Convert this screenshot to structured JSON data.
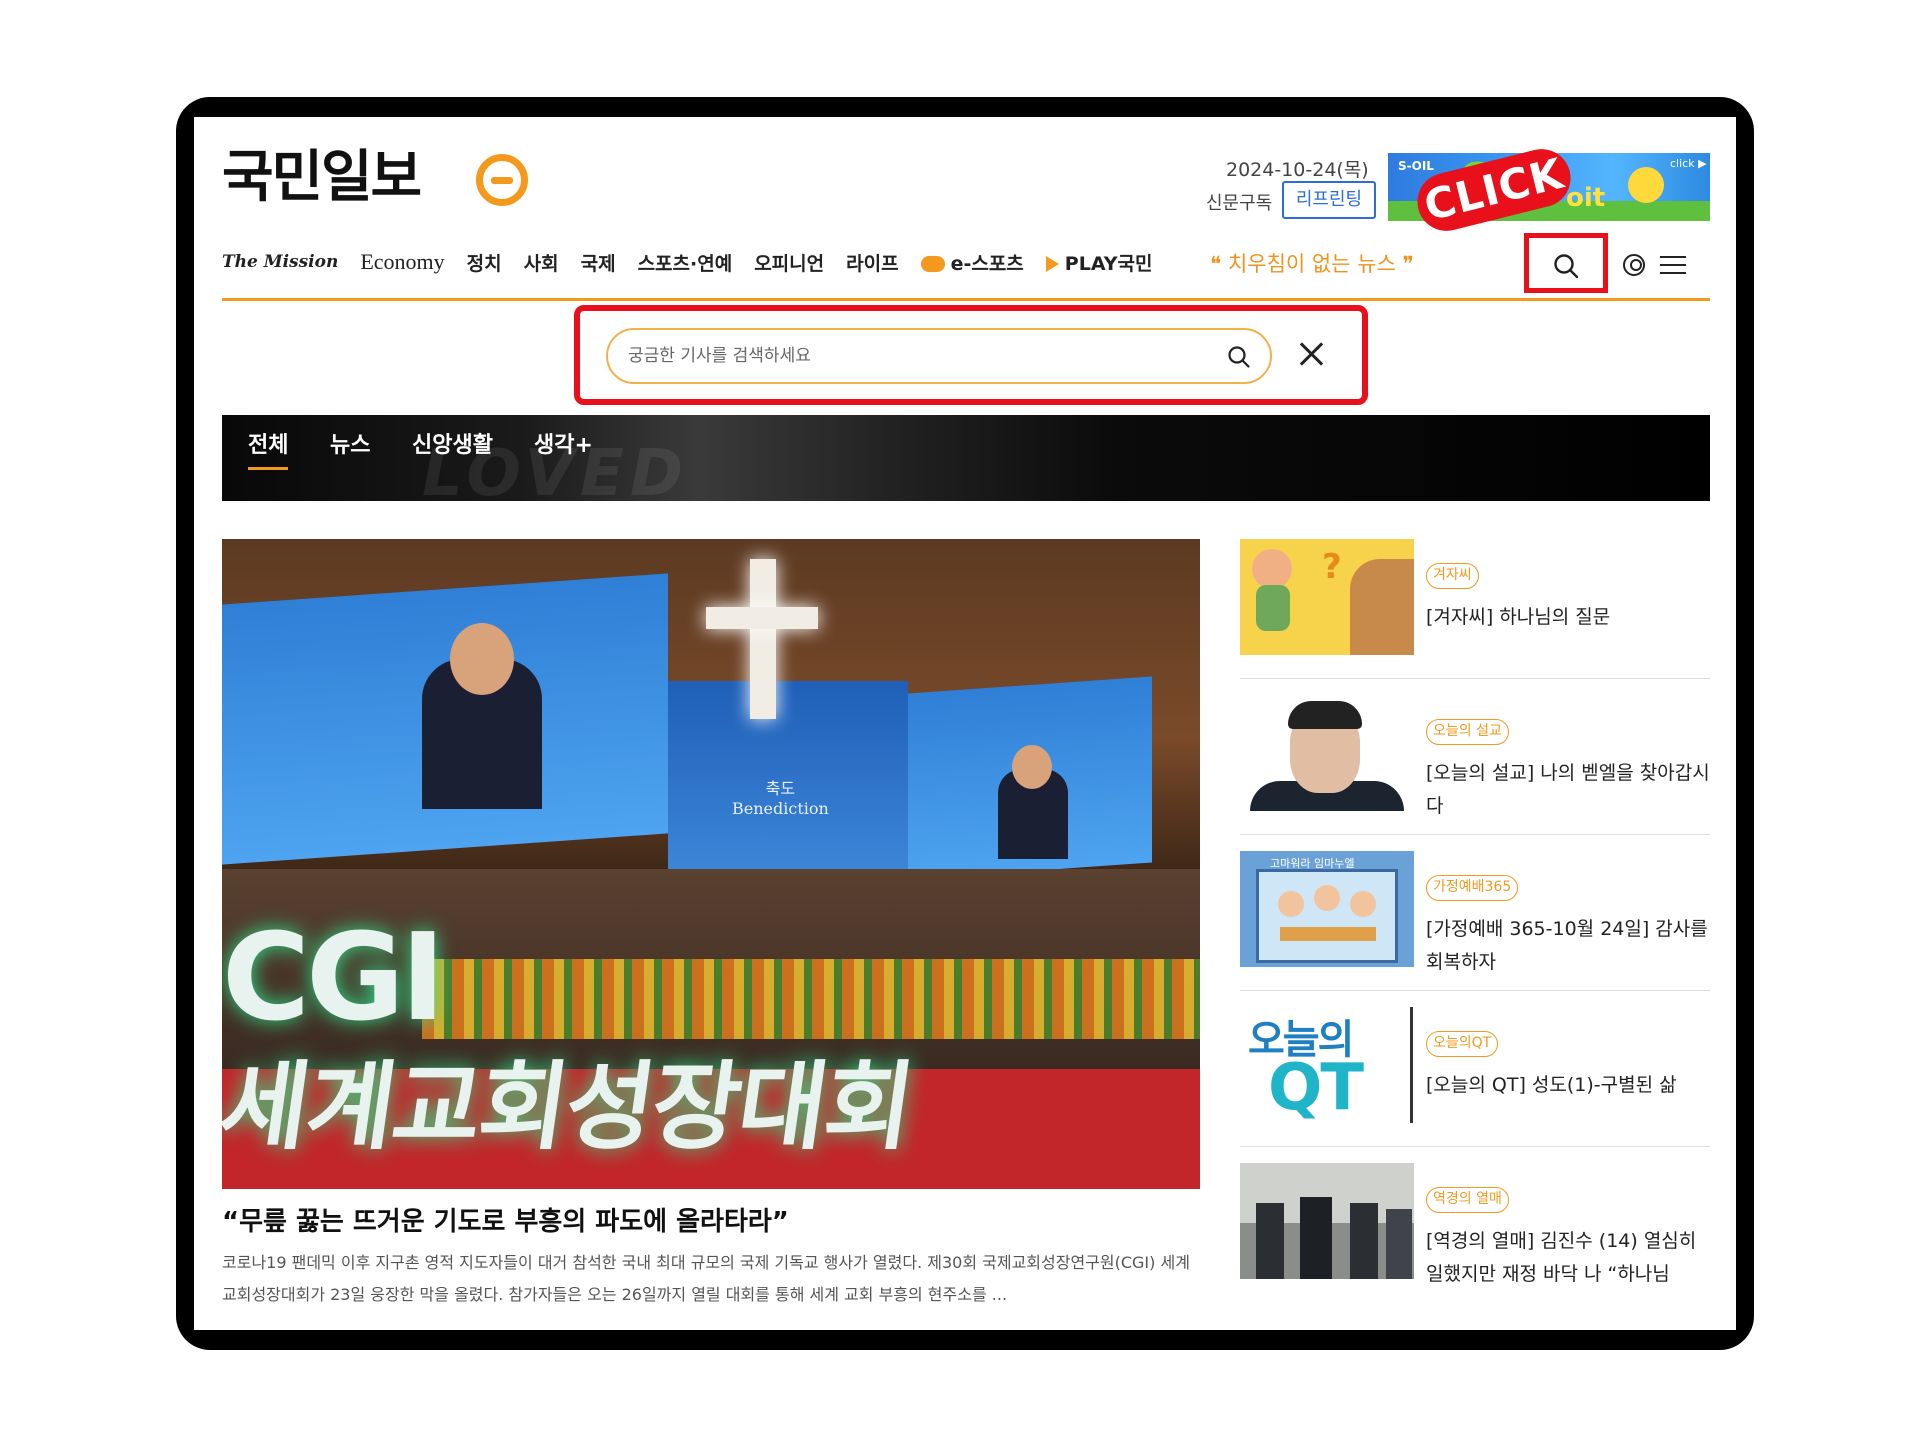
{
  "header": {
    "logo": "국민일보",
    "date": "2024-10-24(목)",
    "subscribe_label": "신문구독",
    "reprint_label": "리프린팅",
    "slogan": "❝ 치우침이 없는 뉴스 ❞",
    "click_badge": "CLICK",
    "banner": {
      "brand": "S-OIL",
      "big_letter": "G",
      "tail": "oit",
      "click": "click ▶"
    }
  },
  "nav": {
    "items": [
      "The Mission",
      "Economy",
      "정치",
      "사회",
      "국제",
      "스포츠·연예",
      "오피니언",
      "라이프",
      "e-스포츠",
      "PLAY국민"
    ]
  },
  "search": {
    "placeholder": "궁금한 기사를 검색하세요",
    "value": ""
  },
  "categories": {
    "tabs": [
      "전체",
      "뉴스",
      "신앙생활",
      "생각+"
    ],
    "active": "전체",
    "background_text": "LOVED"
  },
  "main_article": {
    "image_text": {
      "big": "CGI",
      "sub": "세계교회성장대회",
      "screen_title": "축도",
      "screen_subtitle": "Benediction"
    },
    "headline": "“무릎 꿇는 뜨거운 기도로 부흥의 파도에 올라타라”",
    "summary": "코로나19 팬데믹 이후 지구촌 영적 지도자들이 대거 참석한 국내 최대 규모의 국제 기독교 행사가 열렸다. 제30회 국제교회성장연구원(CGI) 세계교회성장대회가 23일 웅장한 막을 올렸다. 참가자들은 오는 26일까지 열릴 대회를 통해 세계 교회 부흥의 현주소를 ..."
  },
  "side_articles": [
    {
      "tag": "겨자씨",
      "title": "[겨자씨] 하나님의 질문"
    },
    {
      "tag": "오늘의 설교",
      "title": "[오늘의 설교] 나의 벧엘을 찾아갑시다"
    },
    {
      "tag": "가정예배365",
      "title": "[가정예배 365-10월 24일] 감사를 회복하자",
      "thumb_text": "고마워라 임마누엘"
    },
    {
      "tag": "오늘의QT",
      "title": "[오늘의 QT] 성도(1)-구별된 삶",
      "thumb_text_1": "오늘의",
      "thumb_text_2": "QT"
    },
    {
      "tag": "역경의 열매",
      "title": "[역경의 열매] 김진수 (14) 열심히 일했지만 재정 바닥 나 “하나님"
    }
  ],
  "colors": {
    "accent": "#f39a1e",
    "highlight_red": "#e8101a",
    "link_blue": "#2b6fd6"
  }
}
